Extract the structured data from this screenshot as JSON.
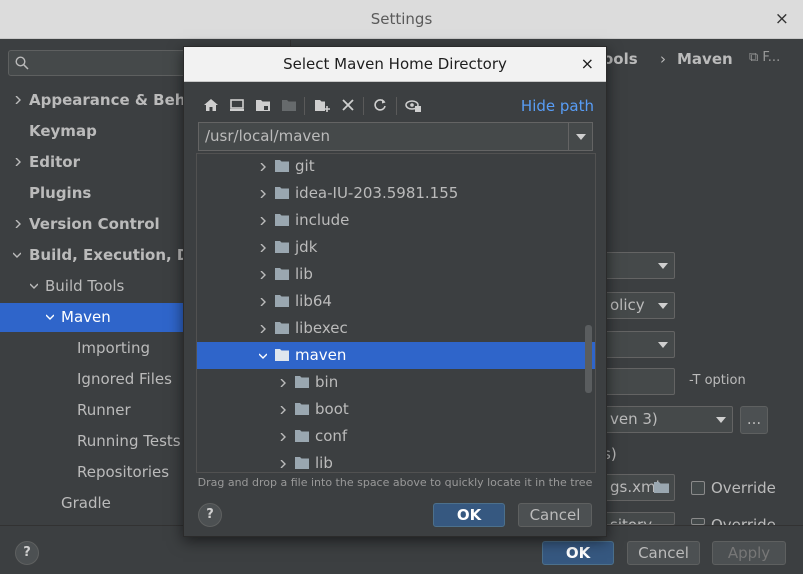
{
  "window": {
    "title": "Settings",
    "close_glyph": "×"
  },
  "sidebar": {
    "items": [
      {
        "label": "Appearance & Behavior",
        "bold": true
      },
      {
        "label": "Keymap",
        "bold": true
      },
      {
        "label": "Editor",
        "bold": true
      },
      {
        "label": "Plugins",
        "bold": true
      },
      {
        "label": "Version Control",
        "bold": true
      },
      {
        "label": "Build, Execution, Deployment",
        "bold": true
      },
      {
        "label": "Build Tools",
        "bold": false
      },
      {
        "label": "Maven",
        "bold": false
      },
      {
        "label": "Importing",
        "bold": false
      },
      {
        "label": "Ignored Files",
        "bold": false
      },
      {
        "label": "Runner",
        "bold": false
      },
      {
        "label": "Running Tests",
        "bold": false
      },
      {
        "label": "Repositories",
        "bold": false
      },
      {
        "label": "Gradle",
        "bold": false
      }
    ]
  },
  "right_panel": {
    "breadcrumb_part": "ools",
    "breadcrumb_sep": "›",
    "breadcrumb_current": "Maven",
    "breadcrumb_tail": "⧉ F...",
    "policy_field": "olicy",
    "t_option": "-T option",
    "home_field": "ven 3)",
    "browse": "...",
    "paren": "s)",
    "settings_field": "gs.xml",
    "repo_field": "sitory",
    "override": "Override"
  },
  "footer": {
    "help": "?",
    "ok": "OK",
    "cancel": "Cancel",
    "apply": "Apply"
  },
  "dialog": {
    "title": "Select Maven Home Directory",
    "close_glyph": "×",
    "hide_path": "Hide path",
    "path": "/usr/local/maven",
    "folders": [
      {
        "name": "git",
        "depth": 0,
        "selected": false,
        "expanded": false
      },
      {
        "name": "idea-IU-203.5981.155",
        "depth": 0,
        "selected": false,
        "expanded": false
      },
      {
        "name": "include",
        "depth": 0,
        "selected": false,
        "expanded": false
      },
      {
        "name": "jdk",
        "depth": 0,
        "selected": false,
        "expanded": false
      },
      {
        "name": "lib",
        "depth": 0,
        "selected": false,
        "expanded": false
      },
      {
        "name": "lib64",
        "depth": 0,
        "selected": false,
        "expanded": false
      },
      {
        "name": "libexec",
        "depth": 0,
        "selected": false,
        "expanded": false
      },
      {
        "name": "maven",
        "depth": 0,
        "selected": true,
        "expanded": true
      },
      {
        "name": "bin",
        "depth": 1,
        "selected": false,
        "expanded": false
      },
      {
        "name": "boot",
        "depth": 1,
        "selected": false,
        "expanded": false
      },
      {
        "name": "conf",
        "depth": 1,
        "selected": false,
        "expanded": false
      },
      {
        "name": "lib",
        "depth": 1,
        "selected": false,
        "expanded": false
      }
    ],
    "hint": "Drag and drop a file into the space above to quickly locate it in the tree",
    "help": "?",
    "ok": "OK",
    "cancel": "Cancel"
  },
  "colors": {
    "selection": "#2f65ca",
    "link": "#589df6",
    "primary_button": "#365880",
    "background": "#3c3f41"
  }
}
